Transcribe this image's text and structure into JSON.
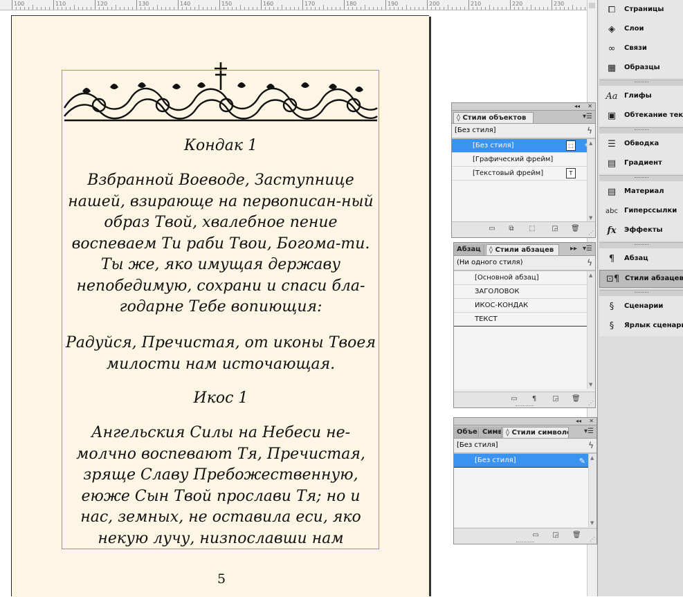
{
  "ruler": {
    "labels": [
      "100",
      "110",
      "120",
      "130",
      "140",
      "150",
      "160",
      "170",
      "180",
      "190",
      "200",
      "210",
      "220",
      "230"
    ]
  },
  "document": {
    "heading1": "Кондак 1",
    "paragraph1": "Взбранной Воеводе, Заступнице нашей, взирающе на первописан-ный образ Твой, хвалебное пение воспеваем Ти раби Твои, Богома-ти. Ты же, яко имущая державу непобедимую, сохрани и спаси бла-годарне Тебе вопиющия:",
    "refrain": "Радуйся, Пречистая, от иконы Твоея милости нам источающая.",
    "heading2": "Икос 1",
    "paragraph2": "Ангельския Силы на Небеси не-молчно воспевают Тя, Пречистая, зряще Славу Пребожественную, еюже Сын Твой прослави Тя; но и нас, земных, не оставила еси, яко некую лучу, низпославши нам",
    "page_number": "5"
  },
  "object_styles_panel": {
    "tab": "Стили объектов",
    "current": "[Без стиля]",
    "items": [
      "[Без стиля]",
      "[Графический фрейм]",
      "[Текстовый фрейм]"
    ]
  },
  "paragraph_styles_panel": {
    "tab_inactive": "Абзац",
    "tab": "Стили абзацев",
    "current": "(Ни одного стиля)",
    "items": [
      "[Основной абзац]",
      "ЗАГОЛОВОК",
      "ИКОС-КОНДАК",
      "ТЕКСТ"
    ]
  },
  "character_styles_panel": {
    "tab_inactive1": "Объе",
    "tab_inactive2": "Симв",
    "tab": "Стили символов",
    "current": "[Без стиля]",
    "items": [
      "[Без стиля]"
    ]
  },
  "dock": {
    "pages": "Страницы",
    "layers": "Слои",
    "links": "Связи",
    "swatches": "Образцы",
    "glyphs": "Глифы",
    "text_wrap": "Обтекание тексто",
    "stroke": "Обводка",
    "gradient": "Градиент",
    "material": "Материал",
    "hyperlinks": "Гиперссылки",
    "effects": "Эффекты",
    "paragraph": "Абзац",
    "paragraph_styles": "Стили абзацев",
    "scripts": "Сценарии",
    "script_label": "Ярлык сценария"
  },
  "icons": {
    "glyphs": "Aa",
    "effects": "fx",
    "hyperlinks": "abc",
    "paragraph": "¶"
  },
  "colors": {
    "selection": "#3b93f0",
    "page": "#fdf6e5",
    "frame": "#b57edc"
  }
}
